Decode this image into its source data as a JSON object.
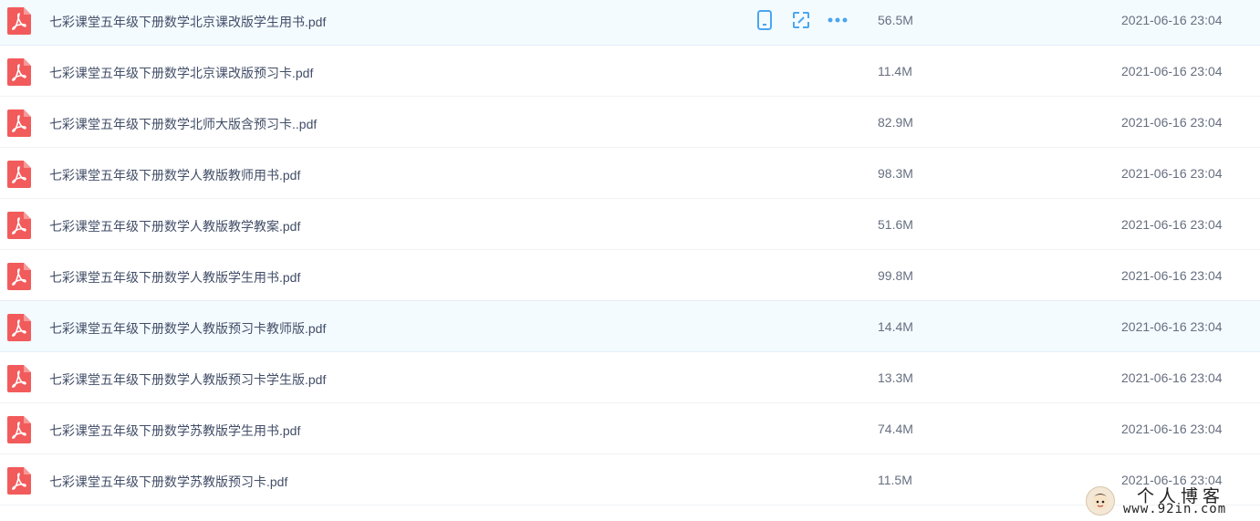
{
  "files": [
    {
      "name": "七彩课堂五年级下册数学北京课改版学生用书.pdf",
      "size": "56.5M",
      "time": "2021-06-16 23:04",
      "hover": true
    },
    {
      "name": "七彩课堂五年级下册数学北京课改版预习卡.pdf",
      "size": "11.4M",
      "time": "2021-06-16 23:04"
    },
    {
      "name": "七彩课堂五年级下册数学北师大版含预习卡..pdf",
      "size": "82.9M",
      "time": "2021-06-16 23:04"
    },
    {
      "name": "七彩课堂五年级下册数学人教版教师用书.pdf",
      "size": "98.3M",
      "time": "2021-06-16 23:04"
    },
    {
      "name": "七彩课堂五年级下册数学人教版教学教案.pdf",
      "size": "51.6M",
      "time": "2021-06-16 23:04"
    },
    {
      "name": "七彩课堂五年级下册数学人教版学生用书.pdf",
      "size": "99.8M",
      "time": "2021-06-16 23:04"
    },
    {
      "name": "七彩课堂五年级下册数学人教版预习卡教师版.pdf",
      "size": "14.4M",
      "time": "2021-06-16 23:04",
      "highlight": true
    },
    {
      "name": "七彩课堂五年级下册数学人教版预习卡学生版.pdf",
      "size": "13.3M",
      "time": "2021-06-16 23:04"
    },
    {
      "name": "七彩课堂五年级下册数学苏教版学生用书.pdf",
      "size": "74.4M",
      "time": "2021-06-16 23:04"
    },
    {
      "name": "七彩课堂五年级下册数学苏教版预习卡.pdf",
      "size": "11.5M",
      "time": "2021-06-16 23:04"
    }
  ],
  "row_actions": [
    "phone-icon",
    "share-link-icon",
    "more-icon"
  ],
  "colors": {
    "pdf_red": "#f25b5b",
    "action_blue": "#4aa6f0",
    "row_hover": "#f4fbff"
  },
  "watermark": {
    "title": "个人博客",
    "url": "www.92in.com"
  }
}
